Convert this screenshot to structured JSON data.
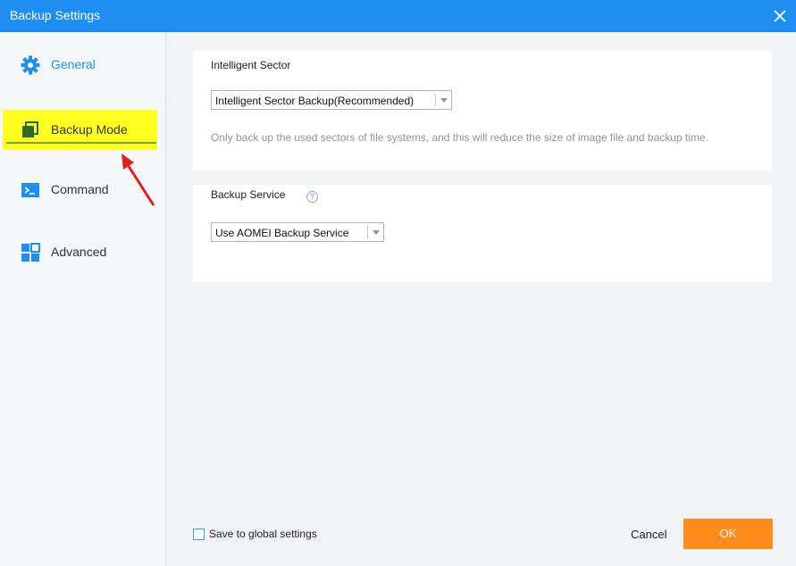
{
  "window": {
    "title": "Backup Settings"
  },
  "sidebar": {
    "items": [
      {
        "label": "General",
        "icon": "gear-icon",
        "color": "#1e8ff0"
      },
      {
        "label": "Backup Mode",
        "icon": "copy-icon"
      },
      {
        "label": "Command",
        "icon": "terminal-icon"
      },
      {
        "label": "Advanced",
        "icon": "grid-icon"
      }
    ]
  },
  "intelligent_sector": {
    "title": "Intelligent Sector",
    "dropdown_value": "Intelligent Sector Backup(Recommended)",
    "description": "Only back up the used sectors of file systems, and this will reduce the size of image file and backup time."
  },
  "backup_service": {
    "title": "Backup Service",
    "help": "?",
    "dropdown_value": "Use AOMEI Backup Service"
  },
  "footer": {
    "save_global_label": "Save to global settings",
    "cancel_label": "Cancel",
    "ok_label": "OK"
  },
  "colors": {
    "accent": "#1e8ff0",
    "ok_button": "#ff8c1a",
    "highlight": "#ffff20"
  }
}
